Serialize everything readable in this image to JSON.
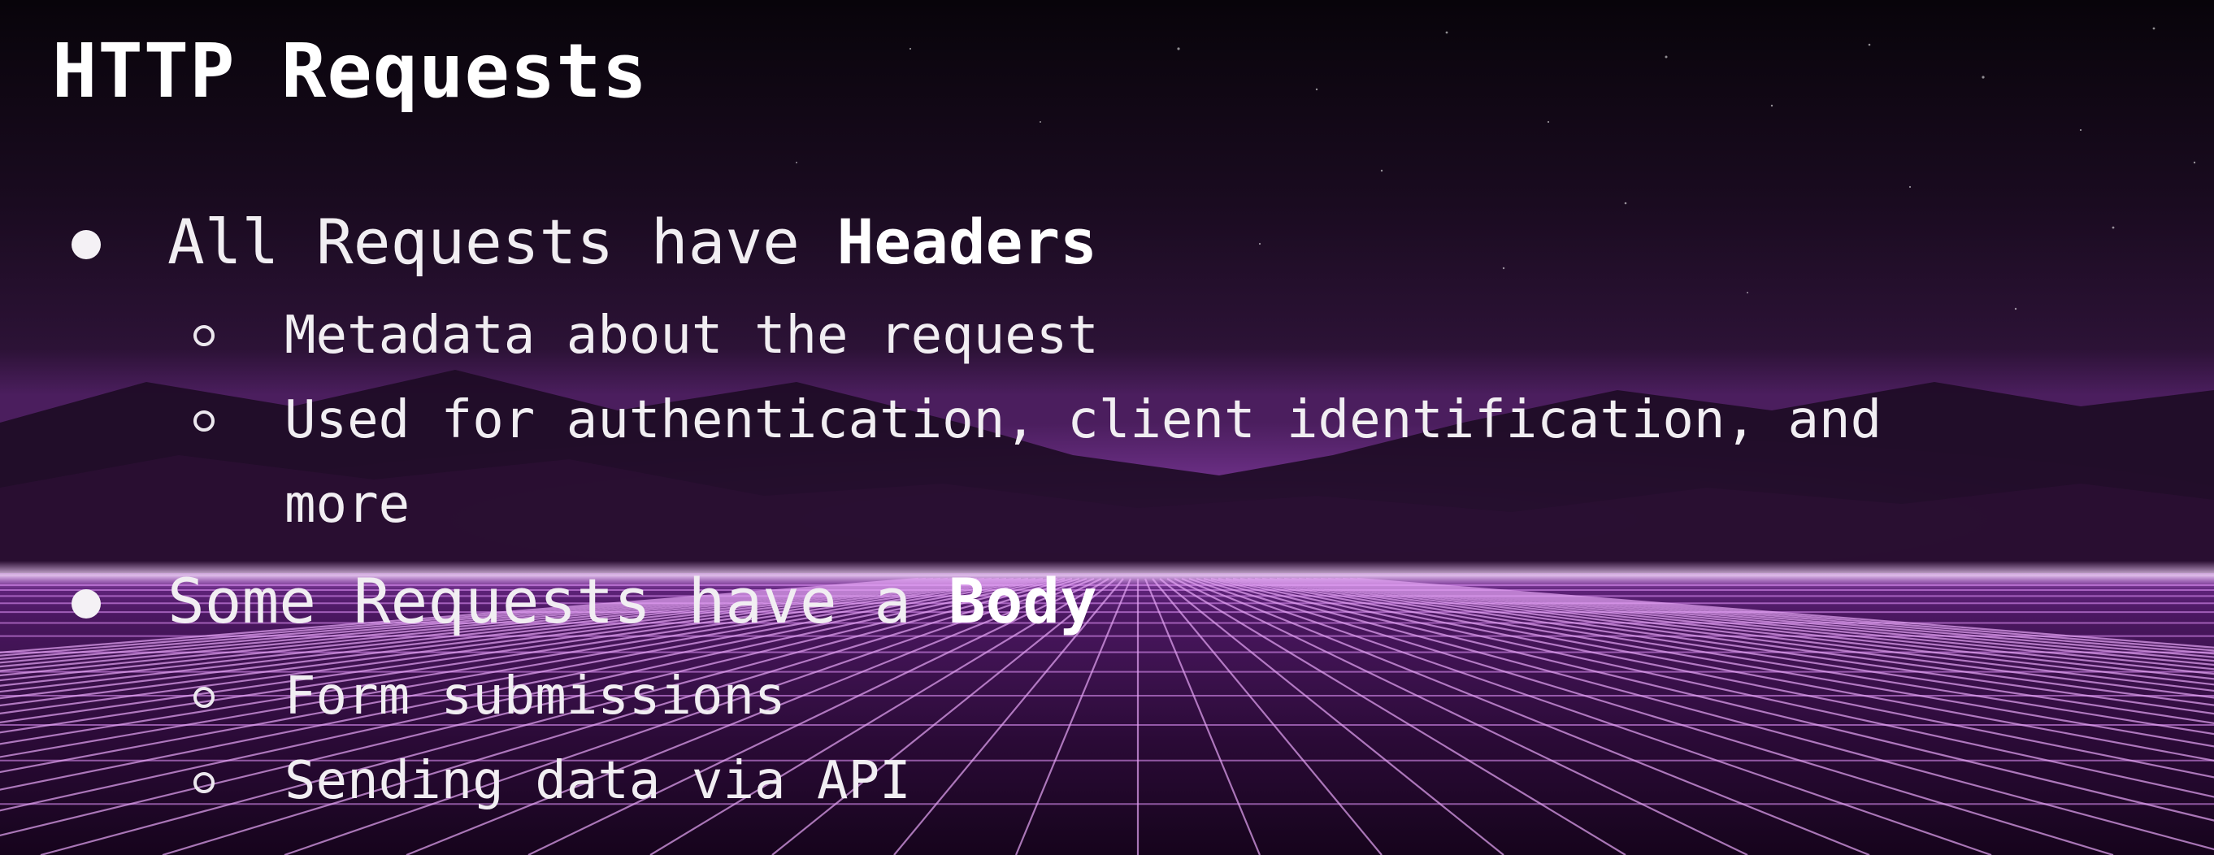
{
  "slide": {
    "title": "HTTP Requests",
    "bullets": [
      {
        "text": "All Requests have ",
        "emphasis": "Headers",
        "sub": [
          "Metadata about the request",
          "Used for authentication, client identification, and",
          "more"
        ]
      },
      {
        "text": "Some Requests have a ",
        "emphasis": "Body",
        "sub": [
          "Form submissions",
          "Sending data via API"
        ]
      }
    ]
  },
  "colors": {
    "text": "#f1eef2",
    "sky_dark": "#0a050c",
    "horizon_glow": "#c06ad8",
    "grid_line": "#d98cf0",
    "floor": "#3a1150"
  }
}
